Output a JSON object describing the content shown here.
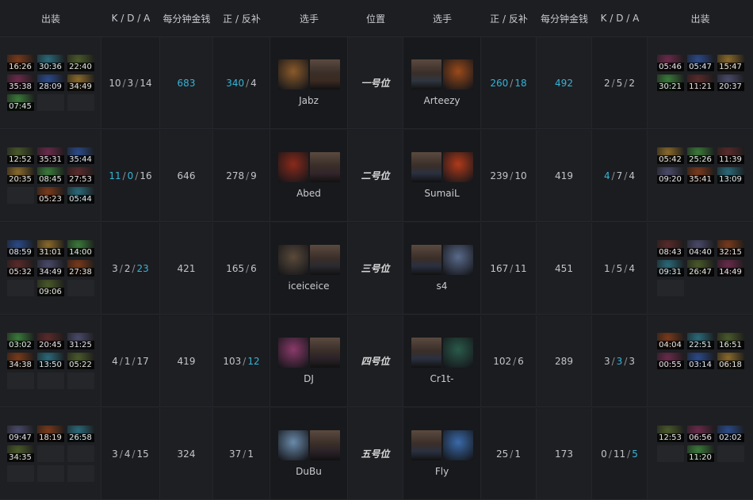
{
  "header": {
    "left_items": "出装",
    "left_kda": "K / D / A",
    "left_gpm": "每分钟金钱",
    "left_lhdn": "正 / 反补",
    "left_player": "选手",
    "position": "位置",
    "right_player": "选手",
    "right_lhdn": "正 / 反补",
    "right_gpm": "每分钟金钱",
    "right_kda": "K / D / A",
    "right_items": "出装"
  },
  "rows": [
    {
      "position": "一号位",
      "left": {
        "items": [
          "16:26",
          "30:36",
          "22:40",
          "35:38",
          "28:09",
          "34:49",
          "07:45"
        ],
        "kda": [
          "10",
          "3",
          "14"
        ],
        "kda_hl": [
          false,
          false,
          false
        ],
        "gpm": "683",
        "gpm_hl": true,
        "lh": "340",
        "dn": "4",
        "lh_hl": true,
        "dn_hl": false,
        "player": "Jabz",
        "hero_color": "#8a5a2a",
        "face_color": "#3a2a22"
      },
      "right": {
        "items": [
          "05:46",
          "05:47",
          "15:47",
          "30:21",
          "11:21",
          "20:37"
        ],
        "kda": [
          "2",
          "5",
          "2"
        ],
        "kda_hl": [
          false,
          false,
          false
        ],
        "gpm": "492",
        "gpm_hl": true,
        "lh": "260",
        "dn": "18",
        "lh_hl": true,
        "dn_hl": true,
        "player": "Arteezy",
        "hero_color": "#9a4a1a",
        "face_color": "#2f3640"
      }
    },
    {
      "position": "二号位",
      "left": {
        "items": [
          "12:52",
          "35:31",
          "35:44",
          "20:35",
          "08:45",
          "27:53",
          "",
          "05:23",
          "05:44"
        ],
        "kda": [
          "11",
          "0",
          "16"
        ],
        "kda_hl": [
          true,
          true,
          false
        ],
        "gpm": "646",
        "gpm_hl": false,
        "lh": "278",
        "dn": "9",
        "lh_hl": false,
        "dn_hl": false,
        "player": "Abed",
        "hero_color": "#8a2a1a",
        "face_color": "#33252a"
      },
      "right": {
        "items": [
          "05:42",
          "25:26",
          "11:39",
          "09:20",
          "35:41",
          "13:09"
        ],
        "kda": [
          "4",
          "7",
          "4"
        ],
        "kda_hl": [
          true,
          false,
          false
        ],
        "gpm": "419",
        "gpm_hl": false,
        "lh": "239",
        "dn": "10",
        "lh_hl": false,
        "dn_hl": false,
        "player": "SumaiL",
        "hero_color": "#b03a1a",
        "face_color": "#2a3040"
      }
    },
    {
      "position": "三号位",
      "left": {
        "items": [
          "08:59",
          "31:01",
          "14:00",
          "05:32",
          "34:49",
          "27:38",
          "",
          "09:06",
          ""
        ],
        "kda": [
          "3",
          "2",
          "23"
        ],
        "kda_hl": [
          false,
          false,
          true
        ],
        "gpm": "421",
        "gpm_hl": false,
        "lh": "165",
        "dn": "6",
        "lh_hl": false,
        "dn_hl": false,
        "player": "iceiceice",
        "hero_color": "#5a4a3a",
        "face_color": "#2a2a30"
      },
      "right": {
        "items": [
          "08:43",
          "04:40",
          "32:15",
          "09:31",
          "26:47",
          "14:49",
          ""
        ],
        "kda": [
          "1",
          "5",
          "4"
        ],
        "kda_hl": [
          false,
          false,
          false
        ],
        "gpm": "451",
        "gpm_hl": false,
        "lh": "167",
        "dn": "11",
        "lh_hl": false,
        "dn_hl": false,
        "player": "s4",
        "hero_color": "#5a6a8a",
        "face_color": "#2a3040"
      }
    },
    {
      "position": "四号位",
      "left": {
        "items": [
          "03:02",
          "20:45",
          "31:25",
          "34:38",
          "13:50",
          "05:22",
          "",
          "",
          ""
        ],
        "kda": [
          "4",
          "1",
          "17"
        ],
        "kda_hl": [
          false,
          false,
          false
        ],
        "gpm": "419",
        "gpm_hl": false,
        "lh": "103",
        "dn": "12",
        "lh_hl": false,
        "dn_hl": true,
        "player": "DJ",
        "hero_color": "#8a3a6a",
        "face_color": "#2a2228"
      },
      "right": {
        "items": [
          "04:04",
          "22:51",
          "16:51",
          "00:55",
          "03:14",
          "06:18"
        ],
        "kda": [
          "3",
          "3",
          "3"
        ],
        "kda_hl": [
          false,
          true,
          false
        ],
        "gpm": "289",
        "gpm_hl": false,
        "lh": "102",
        "dn": "6",
        "lh_hl": false,
        "dn_hl": false,
        "player": "Cr1t-",
        "hero_color": "#2a5a4a",
        "face_color": "#2a3040"
      }
    },
    {
      "position": "五号位",
      "left": {
        "items": [
          "09:47",
          "18:19",
          "26:58",
          "34:35",
          "",
          "",
          "",
          "",
          ""
        ],
        "kda": [
          "3",
          "4",
          "15"
        ],
        "kda_hl": [
          false,
          false,
          false
        ],
        "gpm": "324",
        "gpm_hl": false,
        "lh": "37",
        "dn": "1",
        "lh_hl": false,
        "dn_hl": false,
        "player": "DuBu",
        "hero_color": "#6a8aaa",
        "face_color": "#2a2228"
      },
      "right": {
        "items": [
          "12:53",
          "06:56",
          "02:02",
          "",
          "11:20",
          ""
        ],
        "kda": [
          "0",
          "11",
          "5"
        ],
        "kda_hl": [
          false,
          false,
          true
        ],
        "gpm": "173",
        "gpm_hl": false,
        "lh": "25",
        "dn": "1",
        "lh_hl": false,
        "dn_hl": false,
        "player": "Fly",
        "hero_color": "#3a6aaa",
        "face_color": "#2a3040"
      }
    }
  ],
  "item_palette": [
    "#7a3a1a",
    "#2a6a7a",
    "#4a5a2a",
    "#6a2a4a",
    "#2a4a8a",
    "#8a6a2a",
    "#3a7a3a",
    "#5a2a2a",
    "#4a4a6a"
  ]
}
